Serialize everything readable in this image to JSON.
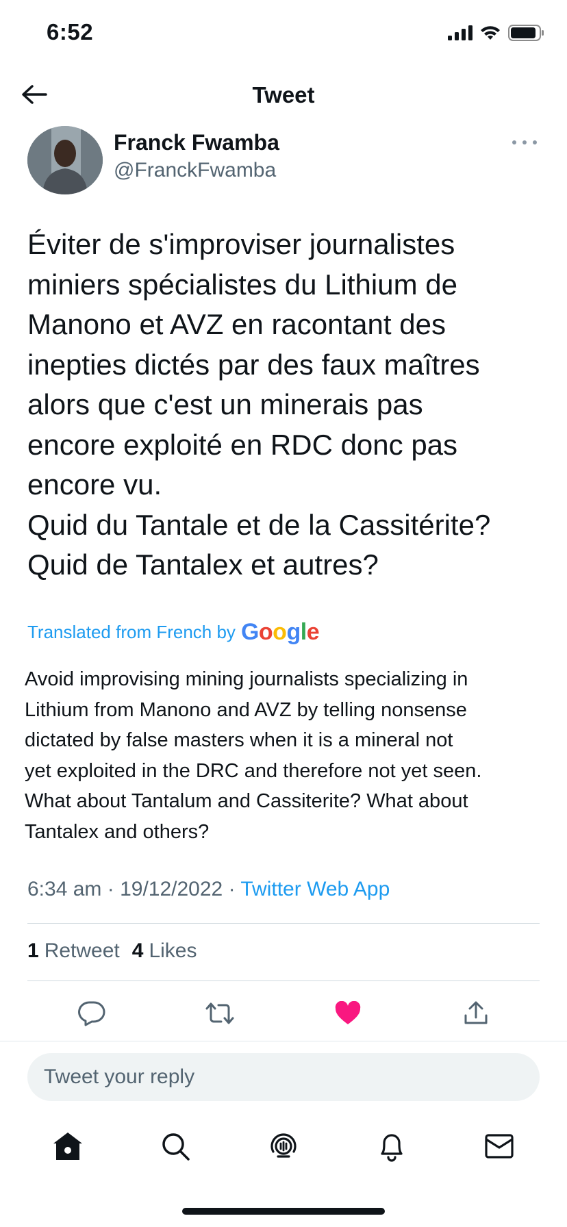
{
  "status_bar": {
    "time": "6:52"
  },
  "header": {
    "title": "Tweet"
  },
  "author": {
    "name": "Franck Fwamba",
    "handle": "@FranckFwamba"
  },
  "tweet": {
    "text": "Éviter de s'improviser journalistes\nminiers spécialistes du Lithium de\nManono et AVZ en racontant des\ninepties dictés par des faux maîtres\nalors que c'est un minerais pas\nencore exploité en RDC donc pas\nencore vu.\nQuid du Tantale et de la Cassitérite?\nQuid de Tantalex et autres?",
    "translated_label": "Translated from French by",
    "translation_provider": "Google",
    "translation": "Avoid improvising mining journalists specializing in\nLithium from Manono and AVZ by telling nonsense\ndictated by false masters when it is a mineral not\nyet exploited in the DRC and therefore not yet seen.\nWhat about Tantalum and Cassiterite? What about\nTantalex and others?",
    "time": "6:34 am",
    "date": "19/12/2022",
    "separator": "·",
    "source": "Twitter Web App",
    "retweets_count": "1",
    "retweets_label": "Retweet",
    "likes_count": "4",
    "likes_label": "Likes",
    "liked": true
  },
  "reply": {
    "placeholder": "Tweet your reply"
  },
  "colors": {
    "accent": "#1d9bf0",
    "like": "#f91880",
    "text": "#0f1419",
    "muted": "#536471"
  },
  "icons": {
    "back": "arrow-left-icon",
    "more": "more-horizontal-icon",
    "reply": "comment-icon",
    "retweet": "retweet-icon",
    "like": "heart-filled-icon",
    "share": "share-icon",
    "home": "home-icon",
    "search": "search-icon",
    "spaces": "spaces-icon",
    "notifications": "bell-icon",
    "messages": "mail-icon"
  }
}
